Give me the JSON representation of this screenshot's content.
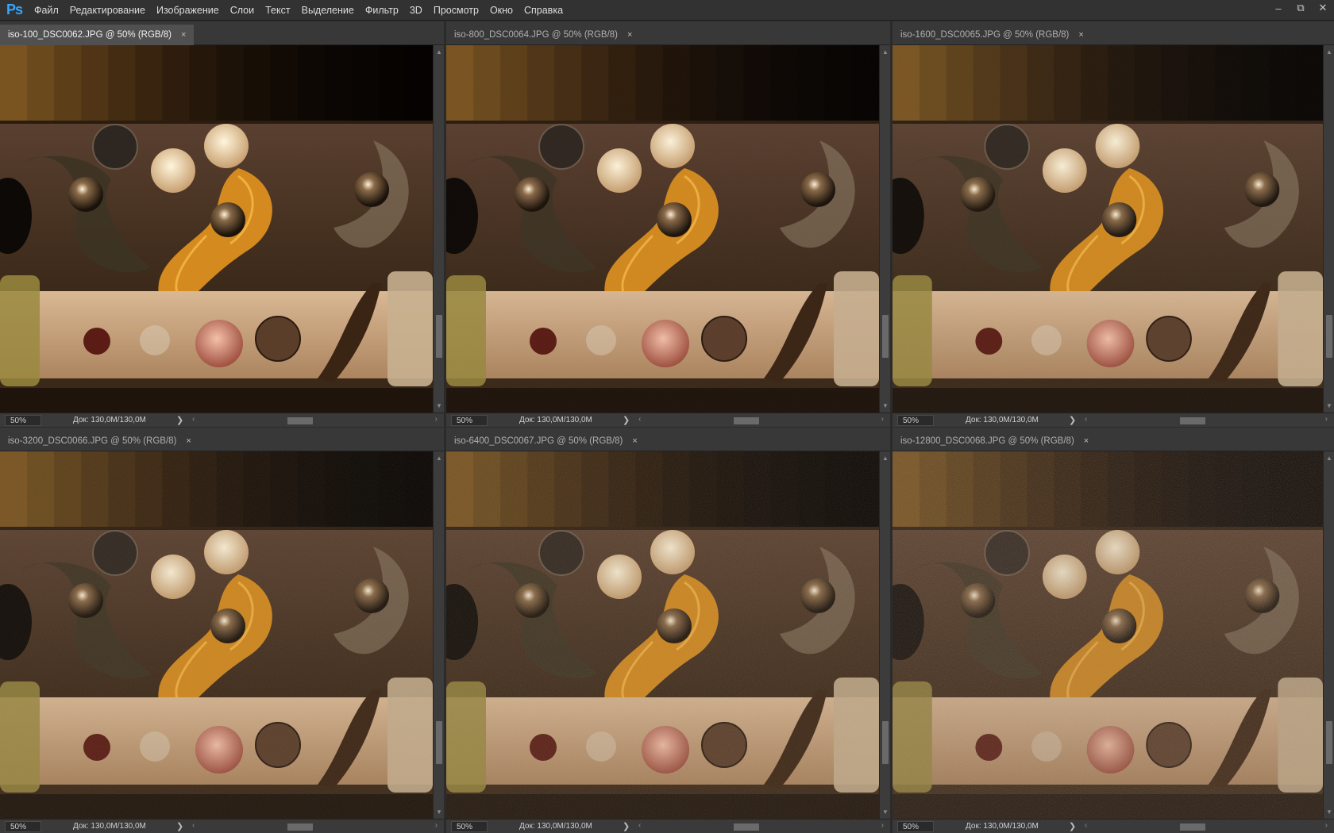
{
  "app": {
    "logo": "Ps"
  },
  "menu": [
    "Файл",
    "Редактирование",
    "Изображение",
    "Слои",
    "Текст",
    "Выделение",
    "Фильтр",
    "3D",
    "Просмотр",
    "Окно",
    "Справка"
  ],
  "window_controls": {
    "minimize": "–",
    "restore": "⧉",
    "close": "✕"
  },
  "colors": {
    "accent": "#31a8ff",
    "panel": "#383838",
    "tab_active": "#505050"
  },
  "documents": [
    {
      "title": "iso-100_DSC0062.JPG @ 50% (RGB/8)",
      "active": true,
      "zoom": "50%",
      "doc_size": "Док: 130,0M/130,0M",
      "noise": 0.0
    },
    {
      "title": "iso-800_DSC0064.JPG @ 50% (RGB/8)",
      "active": false,
      "zoom": "50%",
      "doc_size": "Док: 130,0M/130,0M",
      "noise": 0.1
    },
    {
      "title": "iso-1600_DSC0065.JPG @ 50% (RGB/8)",
      "active": false,
      "zoom": "50%",
      "doc_size": "Док: 130,0M/130,0M",
      "noise": 0.2
    },
    {
      "title": "iso-3200_DSC0066.JPG @ 50% (RGB/8)",
      "active": false,
      "zoom": "50%",
      "doc_size": "Док: 130,0M/130,0M",
      "noise": 0.35
    },
    {
      "title": "iso-6400_DSC0067.JPG @ 50% (RGB/8)",
      "active": false,
      "zoom": "50%",
      "doc_size": "Док: 130,0M/130,0M",
      "noise": 0.5
    },
    {
      "title": "iso-12800_DSC0068.JPG @ 50% (RGB/8)",
      "active": false,
      "zoom": "50%",
      "doc_size": "Док: 130,0M/130,0M",
      "noise": 0.75
    }
  ],
  "tab_close_glyph": "×",
  "status_arrow_glyph": "❯"
}
